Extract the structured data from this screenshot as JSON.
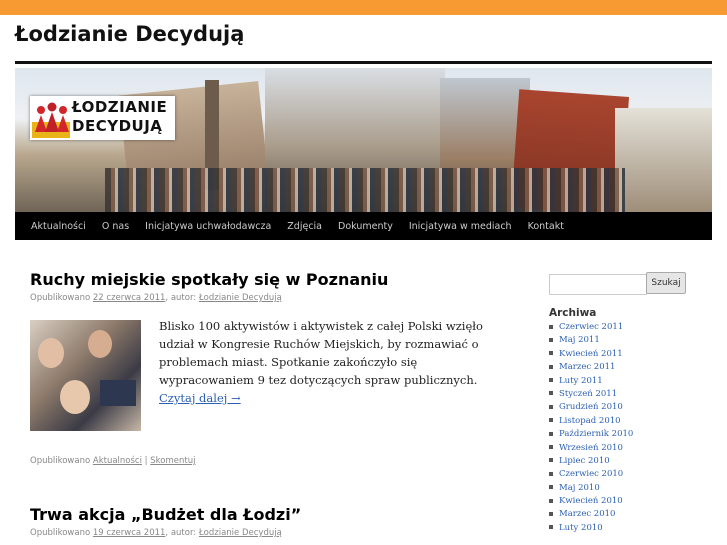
{
  "site": {
    "title": "Łodzianie Decydują",
    "logo_line1": "ŁODZIANIE",
    "logo_line2": "DECYDUJĄ"
  },
  "nav": {
    "items": [
      {
        "label": "Aktualności"
      },
      {
        "label": "O nas"
      },
      {
        "label": "Inicjatywa uchwałodawcza"
      },
      {
        "label": "Zdjęcia"
      },
      {
        "label": "Dokumenty"
      },
      {
        "label": "Inicjatywa w mediach"
      },
      {
        "label": "Kontakt"
      }
    ]
  },
  "posts": [
    {
      "title": "Ruchy miejskie spotkały się w Poznaniu",
      "meta_prefix": "Opublikowano",
      "date": "22 czerwca 2011",
      "meta_author_prefix": ", autor:",
      "author": "Łodzianie Decydują",
      "excerpt": "Blisko 100 aktywistów i aktywistek z całej Polski wzięło udział w Kongresie Ruchów Miejskich, by rozmawiać o problemach miast. Spotkanie zakończyło się wypracowaniem 9 tez dotyczących spraw publicznych.",
      "read_more": "Czytaj dalej →",
      "footer_prefix": "Opublikowano",
      "category": "Aktualności",
      "separator": "|",
      "comments": "Skomentuj"
    },
    {
      "title": "Trwa akcja „Budżet dla Łodzi”",
      "meta_prefix": "Opublikowano",
      "date": "19 czerwca 2011",
      "meta_author_prefix": ", autor:",
      "author": "Łodzianie Decydują"
    }
  ],
  "sidebar": {
    "search_placeholder": "",
    "search_button": "Szukaj",
    "archive_title": "Archiwa",
    "archive_items": [
      "Czerwiec 2011",
      "Maj 2011",
      "Kwiecień 2011",
      "Marzec 2011",
      "Luty 2011",
      "Styczeń 2011",
      "Grudzień 2010",
      "Listopad 2010",
      "Październik 2010",
      "Wrzesień 2010",
      "Lipiec 2010",
      "Czerwiec 2010",
      "Maj 2010",
      "Kwiecień 2010",
      "Marzec 2010",
      "Luty 2010"
    ]
  },
  "colors": {
    "top_bar": "#f79a32",
    "nav_bg": "#000000",
    "link": "#2b5fb3"
  }
}
